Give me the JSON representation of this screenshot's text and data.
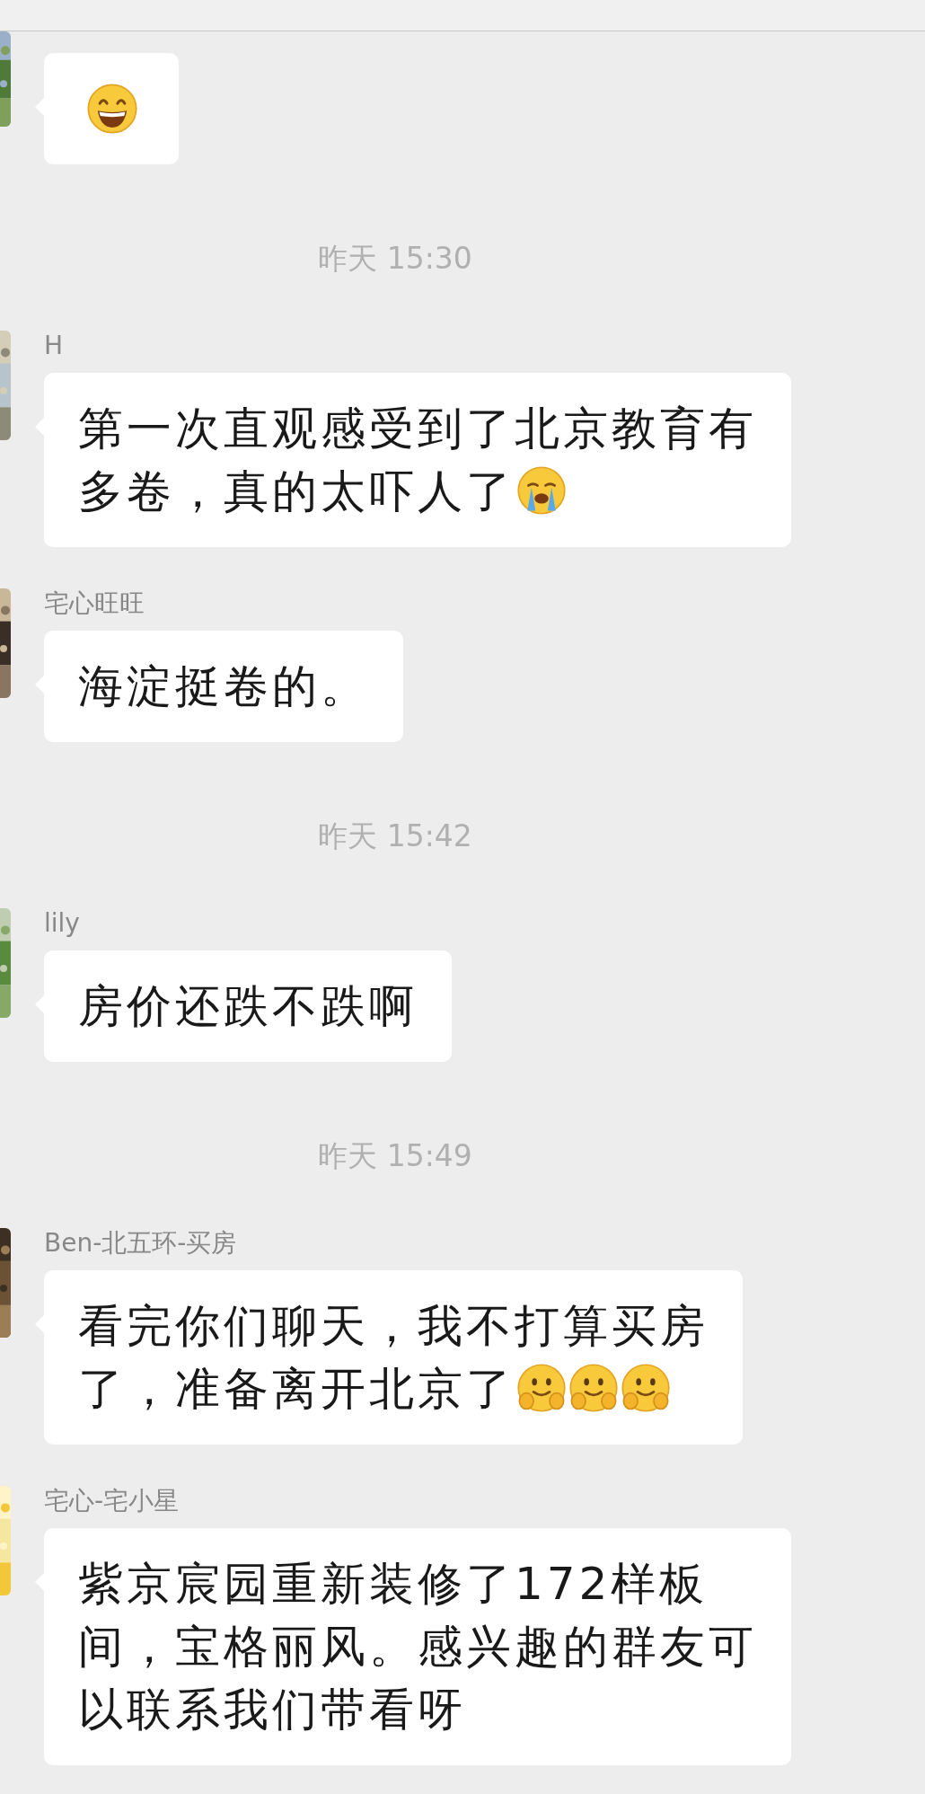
{
  "chat": [
    {
      "kind": "message",
      "emojis": [
        {
          "kind": "grin"
        }
      ]
    },
    {
      "kind": "time",
      "text": "昨天 15:30"
    },
    {
      "kind": "message",
      "name": "H",
      "lines": [
        "第一次直观感受到了北京教育有",
        "多卷，真的太吓人了"
      ],
      "emojis": [
        {
          "kind": "cry"
        }
      ]
    },
    {
      "kind": "message",
      "name": "宅心旺旺",
      "lines": [
        "海淀挺卷的。"
      ]
    },
    {
      "kind": "time",
      "text": "昨天 15:42"
    },
    {
      "kind": "message",
      "name": "lily",
      "lines": [
        "房价还跌不跌啊"
      ]
    },
    {
      "kind": "time",
      "text": "昨天 15:49"
    },
    {
      "kind": "message",
      "name": "Ben-北五环-买房",
      "lines": [
        "看完你们聊天，我不打算买房",
        "了，准备离开北京了"
      ],
      "emojis": [
        {
          "kind": "hug"
        },
        {
          "kind": "hug"
        },
        {
          "kind": "hug"
        }
      ]
    },
    {
      "kind": "message",
      "name": "宅心-宅小星",
      "lines": [
        "紫京宸园重新装修了172样板",
        "间，宝格丽风。感兴趣的群友可",
        "以联系我们带看呀"
      ]
    }
  ]
}
